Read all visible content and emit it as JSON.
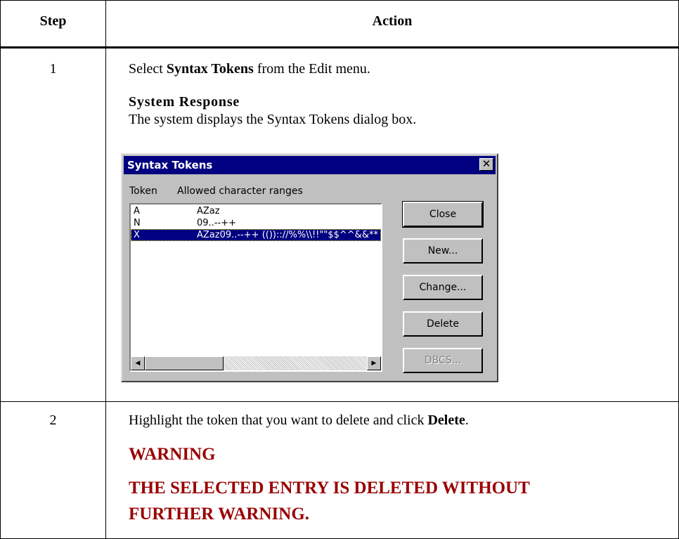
{
  "table": {
    "header_step": "Step",
    "header_action": "Action"
  },
  "rows": [
    {
      "step": "1",
      "line_pre": "Select ",
      "line_bold": "Syntax Tokens",
      "line_post": " from the Edit menu.",
      "system_response_heading": "System Response",
      "system_response_text": "The system displays the Syntax Tokens dialog box."
    },
    {
      "step": "2",
      "line_pre": "Highlight the token that you want to delete and click ",
      "line_bold": "Delete",
      "line_post": ".",
      "warning_heading": "WARNING",
      "warning_line1": "THE SELECTED ENTRY IS DELETED WITHOUT",
      "warning_line2": "FURTHER WARNING."
    }
  ],
  "dialog": {
    "title": "Syntax Tokens",
    "close_glyph": "✕",
    "col_token": "Token",
    "col_ranges": "Allowed character ranges",
    "tokens": [
      {
        "token": "A",
        "ranges": "AZaz"
      },
      {
        "token": "N",
        "ranges": "09..--++"
      },
      {
        "token": "X",
        "ranges": "AZaz09..--++ (()):://%%\\\\!!\"\"$$^^&&**"
      }
    ],
    "selected_index": 2,
    "buttons": {
      "close": "Close",
      "new": "New...",
      "change": "Change...",
      "delete": "Delete",
      "dbcs": "DBCS..."
    },
    "scroll_left_glyph": "◀",
    "scroll_right_glyph": "▶"
  },
  "colors": {
    "warning": "#990000",
    "titlebar": "#000080",
    "dialog_face": "#c0c0c0"
  }
}
